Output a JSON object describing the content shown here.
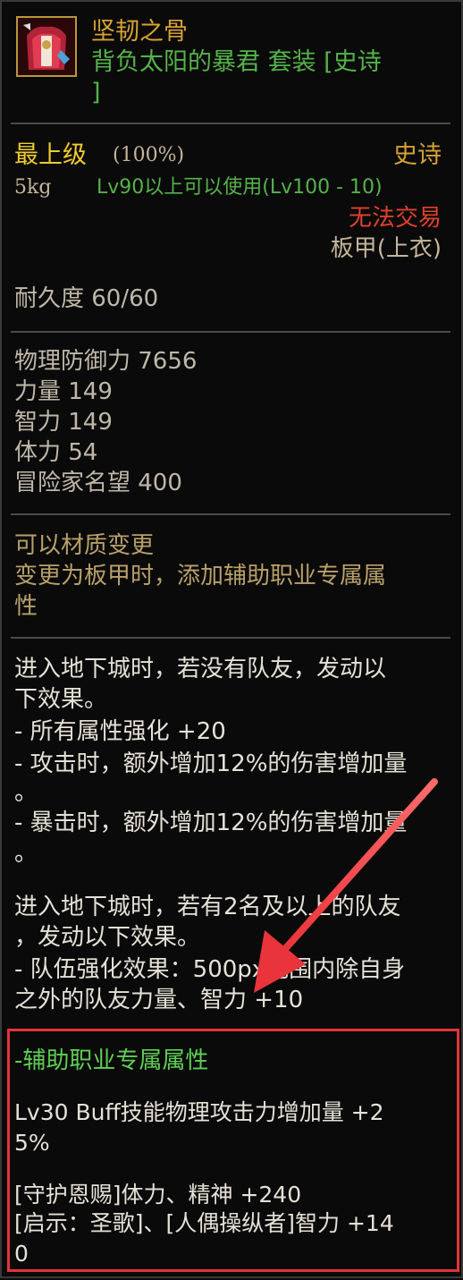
{
  "item": {
    "name": "坚韧之骨",
    "set_line1": "背负太阳的暴君 套装 [史诗",
    "set_line2": "]",
    "grade_label": "最上级",
    "grade_pct": "(100%)",
    "rarity": "史诗",
    "weight": "5kg",
    "level_req": "Lv90以上可以使用(Lv100 - 10)",
    "trade": "无法交易",
    "slot": "板甲(上衣)",
    "durability": "耐久度 60/60"
  },
  "stats": [
    "物理防御力 7656",
    "力量 149",
    "智力 149",
    "体力 54",
    "冒险家名望 400"
  ],
  "material": {
    "line1": "可以材质变更",
    "line2": "变更为板甲时，添加辅助职业专属属",
    "line3": "性"
  },
  "effects": {
    "block1": [
      "进入地下城时，若没有队友，发动以",
      "下效果。",
      "- 所有属性强化 +20",
      "- 攻击时，额外增加12%的伤害增加量",
      "。",
      "- 暴击时，额外增加12%的伤害增加量",
      "。"
    ],
    "block2": [
      "进入地下城时，若有2名及以上的队友",
      "，发动以下效果。",
      "- 队伍强化效果：500px范围内除自身",
      "之外的队友力量、智力 +10"
    ]
  },
  "support": {
    "title": "-辅助职业专属属性",
    "buff_line1": "Lv30 Buff技能物理攻击力增加量 +2",
    "buff_line2": "5%",
    "skill_line1": "[守护恩赐]体力、精神 +240",
    "skill_line2": "[启示：圣歌]、[人偶操纵者]智力 +14",
    "skill_line3": "0"
  },
  "icon": "armor-chest-icon",
  "colors": {
    "border_highlight": "#e2343a",
    "rarity_epic": "#d6a233",
    "set_green": "#55b24a",
    "trade_red": "#e0402e"
  }
}
